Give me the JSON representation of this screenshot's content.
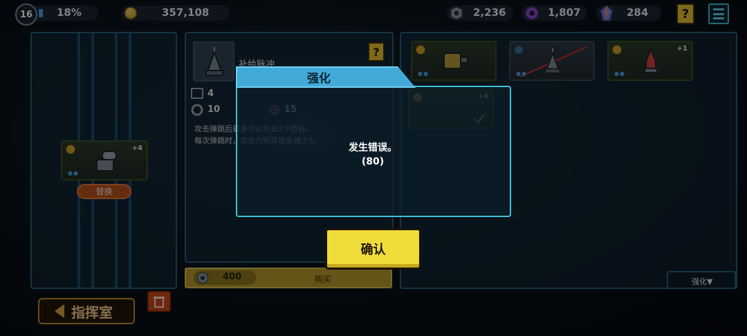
{
  "topbar": {
    "level": "16",
    "progress_pct": "18%",
    "coins": "357,108",
    "bolts": "2,236",
    "gears": "1,807",
    "gems": "284",
    "help_label": "?"
  },
  "left_panel": {
    "card_plus": "+4",
    "swap_label": "替换"
  },
  "item": {
    "name": "补给脉冲",
    "help_label": "?",
    "stat_count": "4",
    "stat_gear": "10",
    "stat_cross": "15",
    "desc_line1": "攻击弹跳后最多可以攻击2个目标。",
    "desc_line2": "每次弹跳时，攻击力和穿透各减少5。",
    "price": "400",
    "buy_label": "购买"
  },
  "right_panel": {
    "cards": [
      {
        "plus": ""
      },
      {
        "plus": ""
      },
      {
        "plus": "+1"
      },
      {
        "plus": "+4"
      }
    ],
    "strength_dropdown": "强化▼"
  },
  "bottom": {
    "back_label": "指挥室"
  },
  "dialog": {
    "title": "强化",
    "message": "发生错误。",
    "code": "(80)",
    "confirm_label": "确认"
  },
  "colors": {
    "accent": "#3ec1d8",
    "confirm": "#f0dc3a",
    "panel_border": "#27607d"
  }
}
